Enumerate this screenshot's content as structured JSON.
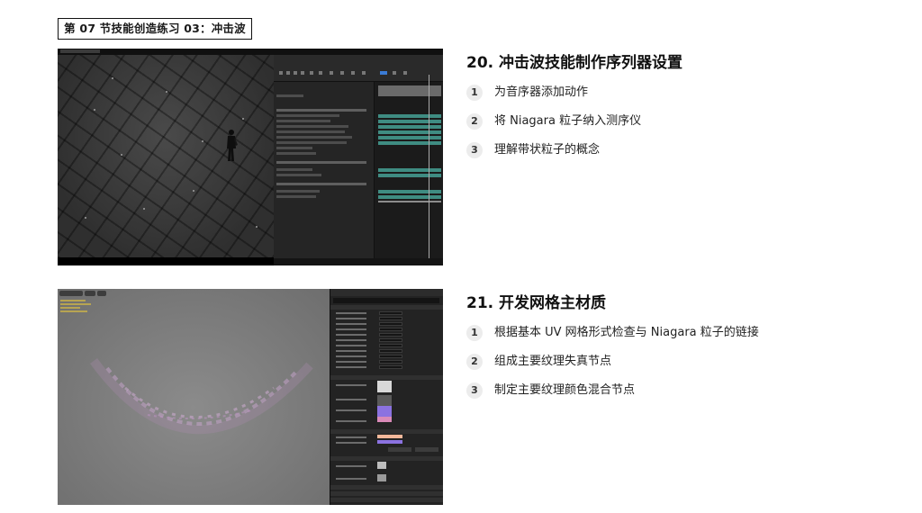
{
  "chapter_tag": "第 07 节技能创造练习 03：冲击波",
  "sections": [
    {
      "title": "20. 冲击波技能制作序列器设置",
      "items": [
        {
          "num": "1",
          "text": "为音序器添加动作"
        },
        {
          "num": "2",
          "text": "将 Niagara 粒子纳入测序仪"
        },
        {
          "num": "3",
          "text": "理解带状粒子的概念"
        }
      ]
    },
    {
      "title": "21. 开发网格主材质",
      "items": [
        {
          "num": "1",
          "text": "根据基本 UV 网格形式检查与 Niagara 粒子的链接"
        },
        {
          "num": "2",
          "text": "组成主要纹理失真节点"
        },
        {
          "num": "3",
          "text": "制定主要纹理颜色混合节点"
        }
      ]
    }
  ],
  "colors": {
    "editor_dark": "#202020",
    "track_teal": "#3f8c82",
    "swatch_purple": "#8b72e0",
    "swatch_peach": "#f2b89a",
    "swatch_pink": "#d98ab8"
  }
}
